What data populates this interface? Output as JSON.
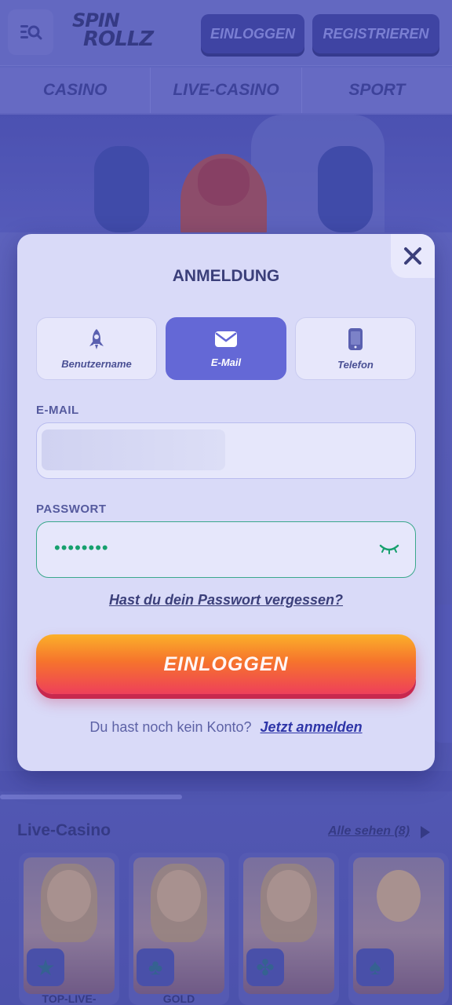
{
  "header": {
    "logo_line1": "SPIN",
    "logo_line2": "ROLLZ",
    "login_label": "EINLOGGEN",
    "register_label": "REGISTRIEREN"
  },
  "nav_tabs": [
    "CASINO",
    "LIVE-CASINO",
    "SPORT"
  ],
  "modal": {
    "title": "ANMELDUNG",
    "tabs": [
      {
        "label": "Benutzername",
        "icon": "rocket-icon",
        "active": false
      },
      {
        "label": "E-Mail",
        "icon": "envelope-icon",
        "active": true
      },
      {
        "label": "Telefon",
        "icon": "phone-icon",
        "active": false
      }
    ],
    "email_label": "E-MAIL",
    "password_label": "PASSWORT",
    "password_mask": "••••••••",
    "forgot_link": "Hast du dein Passwort vergessen?",
    "submit_label": "EINLOGGEN",
    "no_account_text": "Du hast noch kein Konto?",
    "signup_link": "Jetzt anmelden"
  },
  "live_casino": {
    "title": "Live-Casino",
    "see_all": "Alle sehen (8)",
    "games": [
      {
        "label": "TOP-LIVE-",
        "icon": "star-icon"
      },
      {
        "label": "GOLD",
        "icon": "club-icon"
      },
      {
        "label": "",
        "icon": "clover-icon"
      },
      {
        "label": "",
        "icon": "spade-icon"
      }
    ]
  },
  "colors": {
    "accent": "#6468d6",
    "cta_top": "#fbb02a",
    "cta_bottom": "#ee3f5a",
    "password_border": "#3aa88c"
  }
}
